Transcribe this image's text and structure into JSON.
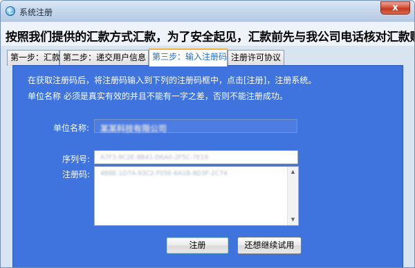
{
  "window": {
    "title": "系统注册",
    "close_label": "x"
  },
  "headline": "按照我们提供的汇款方式汇款，为了安全起见，汇款前先与我公司电话核对汇款账号。",
  "tabs": [
    {
      "label": "第一步：汇款",
      "active": false
    },
    {
      "label": "第二步：递交用户信息",
      "active": false
    },
    {
      "label": "第三步：输入注册码",
      "active": true
    },
    {
      "label": "注册许可协议",
      "active": false
    }
  ],
  "panel": {
    "instruction_line1": "在获取注册码后，将注册码输入到下列的注册码框中，点击[注册]，注册系统。",
    "instruction_line2": "单位名称 必须是真实有效的并且不能有一字之差，否则不能注册成功。",
    "unit_name_label": "单位名称:",
    "unit_name_value": "某某科技有限公司",
    "serial_label": "序列号:",
    "serial_value": "A7F3-9C2E-8B41-D6A0-2F5C-7E19",
    "reg_code_label": "注册码:",
    "reg_code_value": "4B8E-1D7A-93C2-F05E-6A1B-8D3F-2C74"
  },
  "buttons": {
    "register": "注册",
    "trial": "还想继续试用"
  },
  "colors": {
    "panel_bg": "#3f73de",
    "active_tab_text": "#1a6fd0",
    "active_tab_accent": "#f3b340"
  },
  "icons": {
    "app": "app-logo-icon",
    "close": "close-icon",
    "scroll_up": "scroll-up-arrow-icon",
    "scroll_down": "scroll-down-arrow-icon"
  }
}
